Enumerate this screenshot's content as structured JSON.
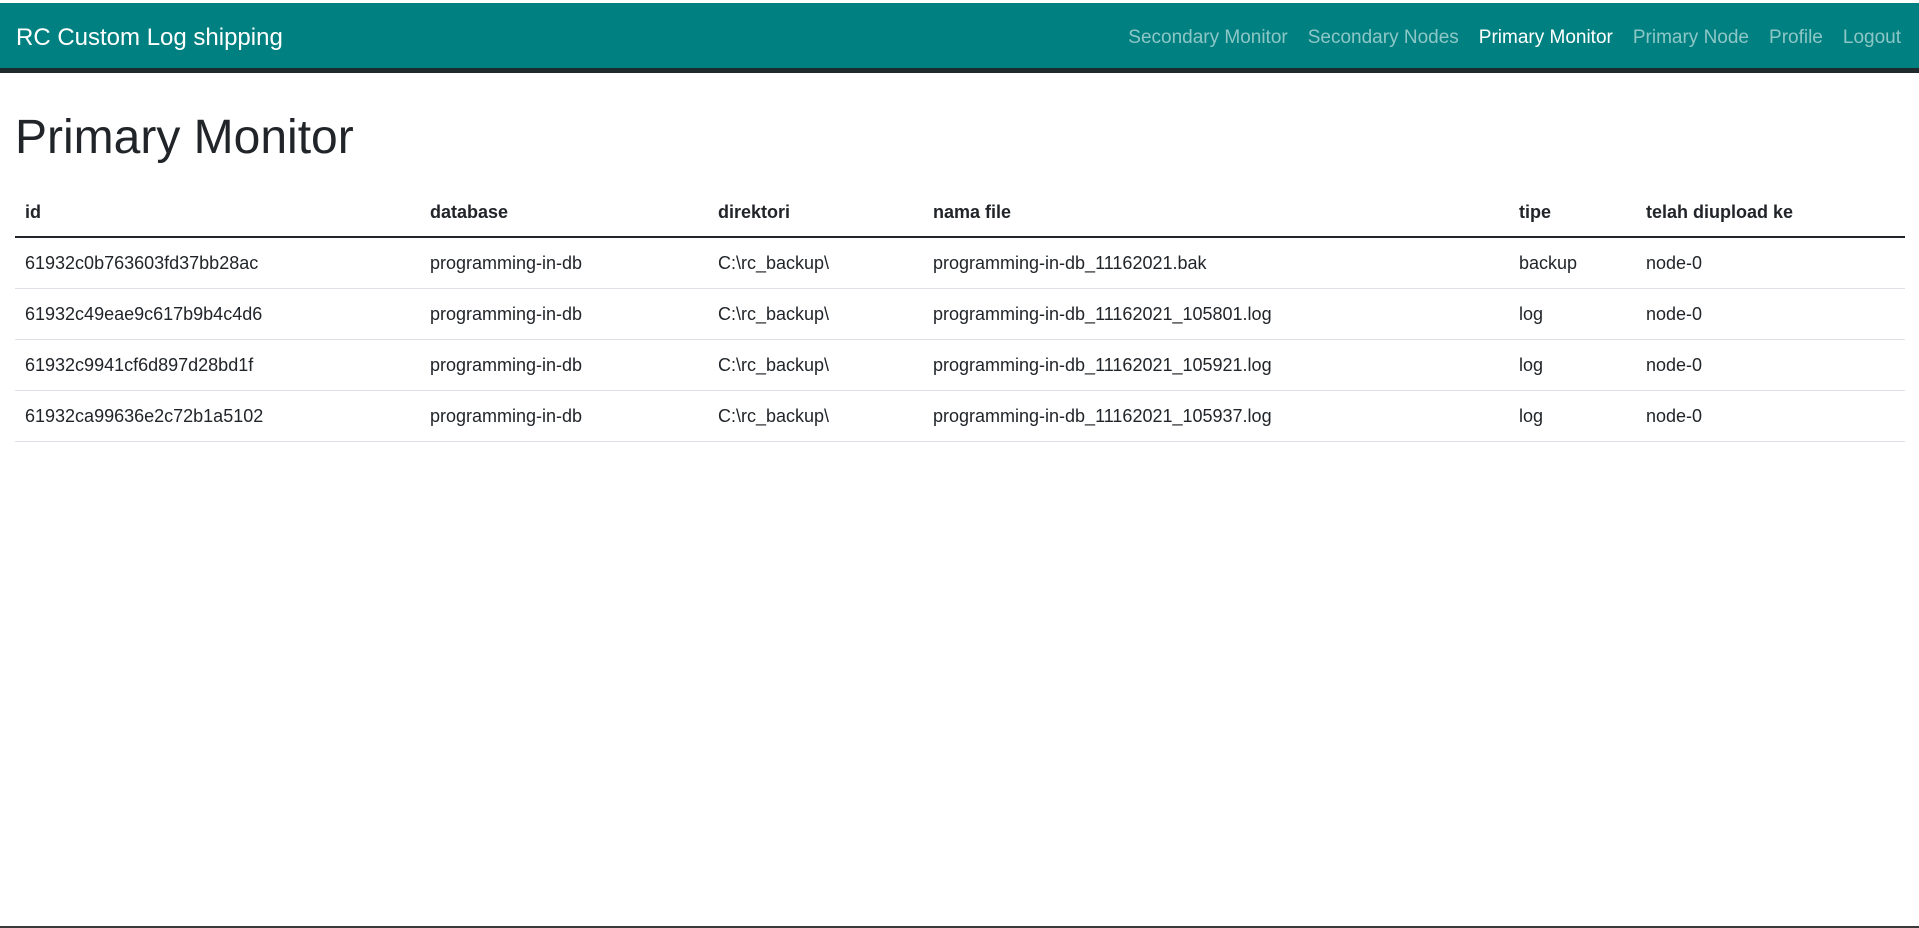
{
  "navbar": {
    "brand": "RC Custom Log shipping",
    "links": [
      {
        "label": "Secondary Monitor",
        "active": false
      },
      {
        "label": "Secondary Nodes",
        "active": false
      },
      {
        "label": "Primary Monitor",
        "active": true
      },
      {
        "label": "Primary Node",
        "active": false
      },
      {
        "label": "Profile",
        "active": false
      },
      {
        "label": "Logout",
        "active": false
      }
    ]
  },
  "main": {
    "title": "Primary Monitor",
    "table": {
      "headers": [
        "id",
        "database",
        "direktori",
        "nama file",
        "tipe",
        "telah diupload ke"
      ],
      "rows": [
        [
          "61932c0b763603fd37bb28ac",
          "programming-in-db",
          "C:\\rc_backup\\",
          "programming-in-db_11162021.bak",
          "backup",
          "node-0"
        ],
        [
          "61932c49eae9c617b9b4c4d6",
          "programming-in-db",
          "C:\\rc_backup\\",
          "programming-in-db_11162021_105801.log",
          "log",
          "node-0"
        ],
        [
          "61932c9941cf6d897d28bd1f",
          "programming-in-db",
          "C:\\rc_backup\\",
          "programming-in-db_11162021_105921.log",
          "log",
          "node-0"
        ],
        [
          "61932ca99636e2c72b1a5102",
          "programming-in-db",
          "C:\\rc_backup\\",
          "programming-in-db_11162021_105937.log",
          "log",
          "node-0"
        ]
      ]
    }
  },
  "colors": {
    "navbar_bg": "#008080",
    "nav_link_inactive": "rgba(255,255,255,0.55)",
    "nav_link_active": "#ffffff"
  }
}
